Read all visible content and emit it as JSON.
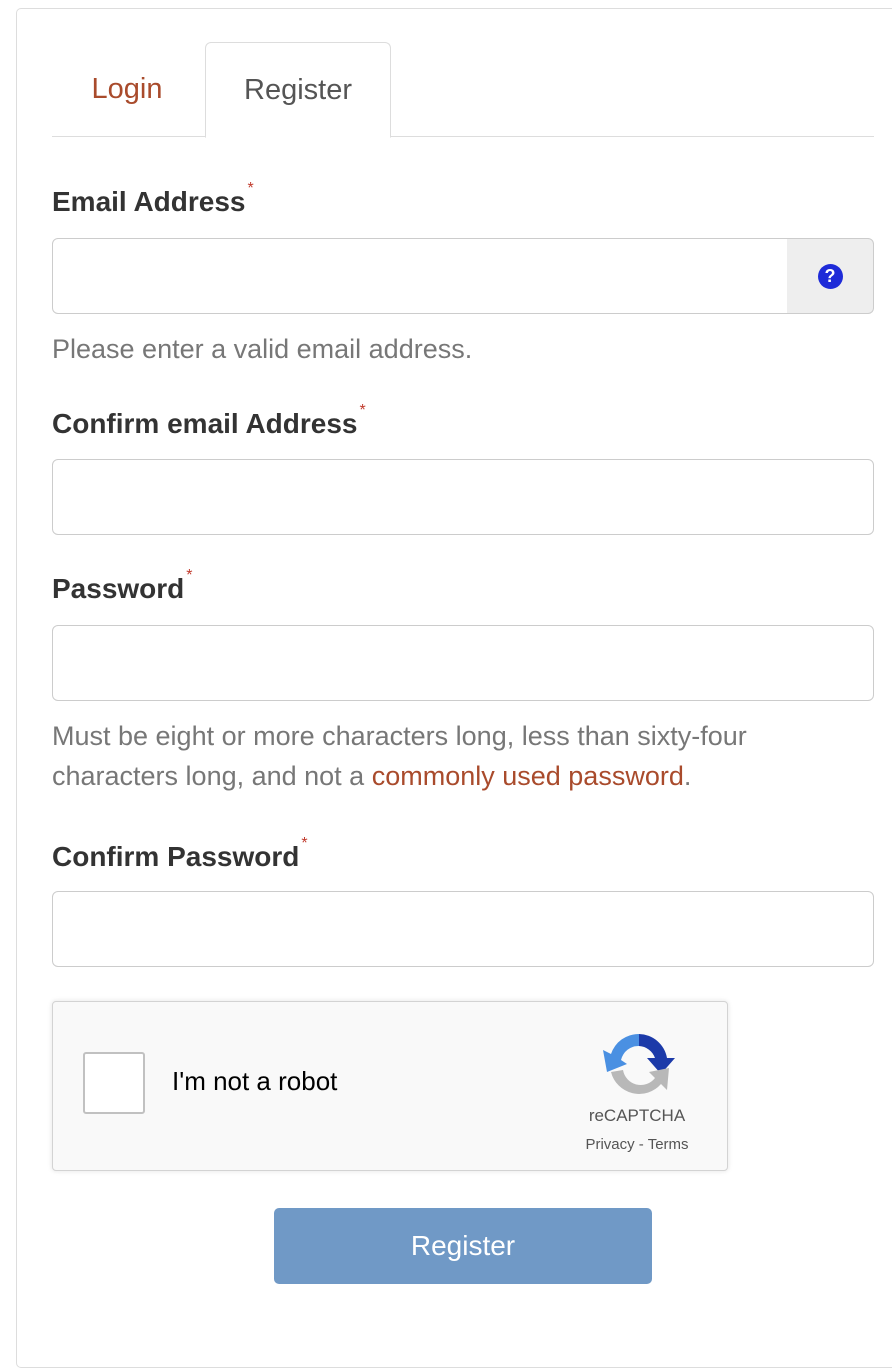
{
  "tabs": [
    {
      "label": "Login",
      "active": false
    },
    {
      "label": "Register",
      "active": true
    }
  ],
  "required_marker": "*",
  "email": {
    "label": "Email Address",
    "value": "",
    "help_icon": "question-circle-icon",
    "hint": "Please enter a valid email address."
  },
  "confirm_email": {
    "label": "Confirm email Address",
    "value": ""
  },
  "password": {
    "label": "Password",
    "value": "",
    "hint_prefix": "Must be eight or more characters long, less than sixty-four characters long, and not a ",
    "hint_link": "commonly used password",
    "hint_suffix": "."
  },
  "confirm_password": {
    "label": "Confirm Password",
    "value": ""
  },
  "captcha": {
    "checkbox_label": "I'm not a robot",
    "brand": "reCAPTCHA",
    "privacy": "Privacy",
    "separator": " - ",
    "terms": "Terms",
    "logo_icon": "recaptcha-logo-icon"
  },
  "submit_label": "Register",
  "colors": {
    "link": "#a94b2c",
    "button": "#7099c6",
    "help_icon": "#1e2bd8",
    "required": "#c0392b"
  }
}
